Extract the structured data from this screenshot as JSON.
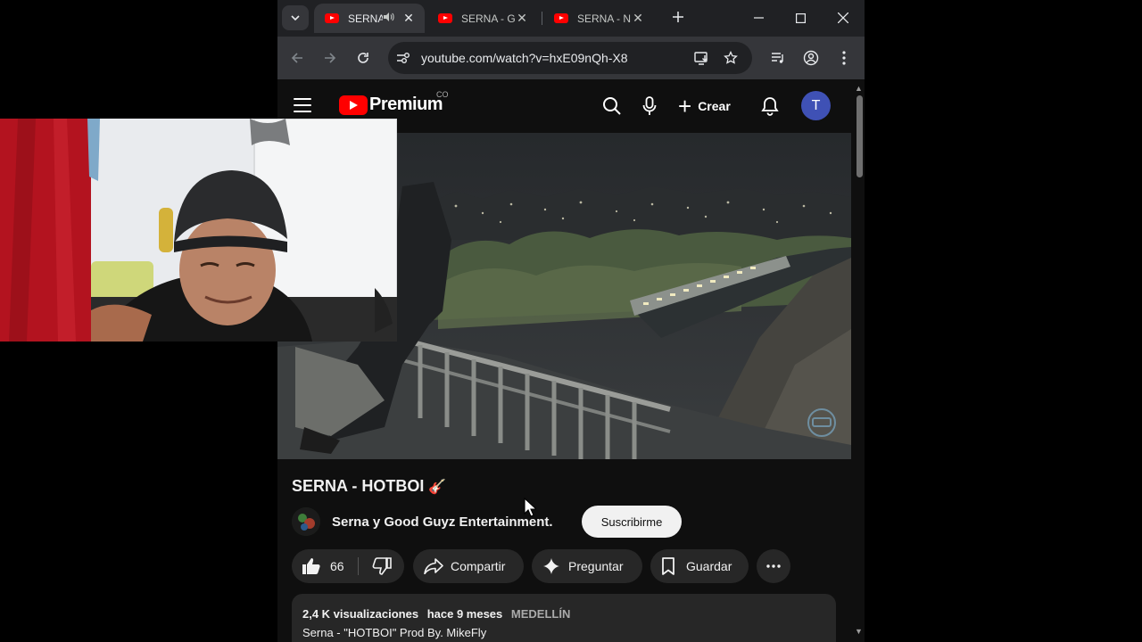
{
  "browser": {
    "tabs": [
      {
        "title": "SERNA",
        "active": true,
        "audio": true
      },
      {
        "title": "SERNA - G",
        "active": false,
        "audio": false
      },
      {
        "title": "SERNA - N",
        "active": false,
        "audio": false
      }
    ],
    "url": "youtube.com/watch?v=hxE09nQh-X8"
  },
  "youtube": {
    "logo_text": "Premium",
    "country_code": "CO",
    "create_label": "Crear",
    "avatar_letter": "T"
  },
  "video": {
    "title": "SERNA - HOTBOI",
    "title_emoji": "🎸",
    "channel": "Serna y Good Guyz Entertainment.",
    "subscribe_label": "Suscribirme",
    "like_count": "66",
    "share_label": "Compartir",
    "ask_label": "Preguntar",
    "save_label": "Guardar",
    "views": "2,4 K visualizaciones",
    "date": "hace 9 meses",
    "location": "MEDELLÍN",
    "description": "Serna - \"HOTBOI\" Prod By. MikeFly"
  },
  "colors": {
    "yt_red": "#ff0000",
    "background": "#0f0f0f",
    "pill": "#272727",
    "avatar": "#3f51b5"
  }
}
